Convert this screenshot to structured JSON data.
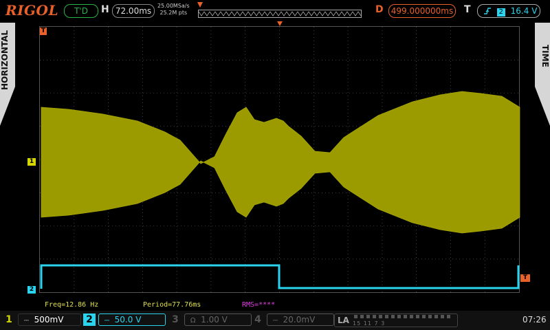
{
  "header": {
    "logo": "RIGOL",
    "trigger_status": "T'D",
    "h_label": "H",
    "timebase": "72.00ms",
    "sample_rate": "25.00MSa/s",
    "memory_depth": "25.2M pts",
    "d_label": "D",
    "delay": "499.000000ms",
    "t_label": "T",
    "trigger_source": "2",
    "trigger_level": "16.4 V",
    "trigger_edge_icon": "rising-edge-icon"
  },
  "side_tabs": {
    "left": "HORIZONTAL",
    "right": "TIME"
  },
  "markers": {
    "ch1": "1",
    "ch2": "2",
    "trigger_level": "T",
    "trigger_position": "T"
  },
  "measurements": {
    "freq": "Freq=12.86 Hz",
    "period": "Period=77.76ms",
    "rms": "RMS=****"
  },
  "channels": [
    {
      "num": "1",
      "coupling_icon": "dc-coupling-icon",
      "scale": "500mV",
      "color": "#d5d500",
      "active": true
    },
    {
      "num": "2",
      "coupling_icon": "dc-coupling-icon",
      "scale": "50.0 V",
      "color": "#2ad4ee",
      "active": true
    },
    {
      "num": "3",
      "coupling_icon": "ohm-icon",
      "scale": "1.00 V",
      "color": "#555555",
      "active": false
    },
    {
      "num": "4",
      "coupling_icon": "dc-coupling-icon",
      "scale": "20.0mV",
      "color": "#555555",
      "active": false
    }
  ],
  "logic_analyzer": {
    "label": "LA",
    "channels_hint": "15  11  7  3"
  },
  "clock": "07:26",
  "colors": {
    "ch1": "#d5d500",
    "ch2": "#2ad4ee",
    "accent": "#e8612a",
    "trigger_ok": "#2bb34a"
  }
}
